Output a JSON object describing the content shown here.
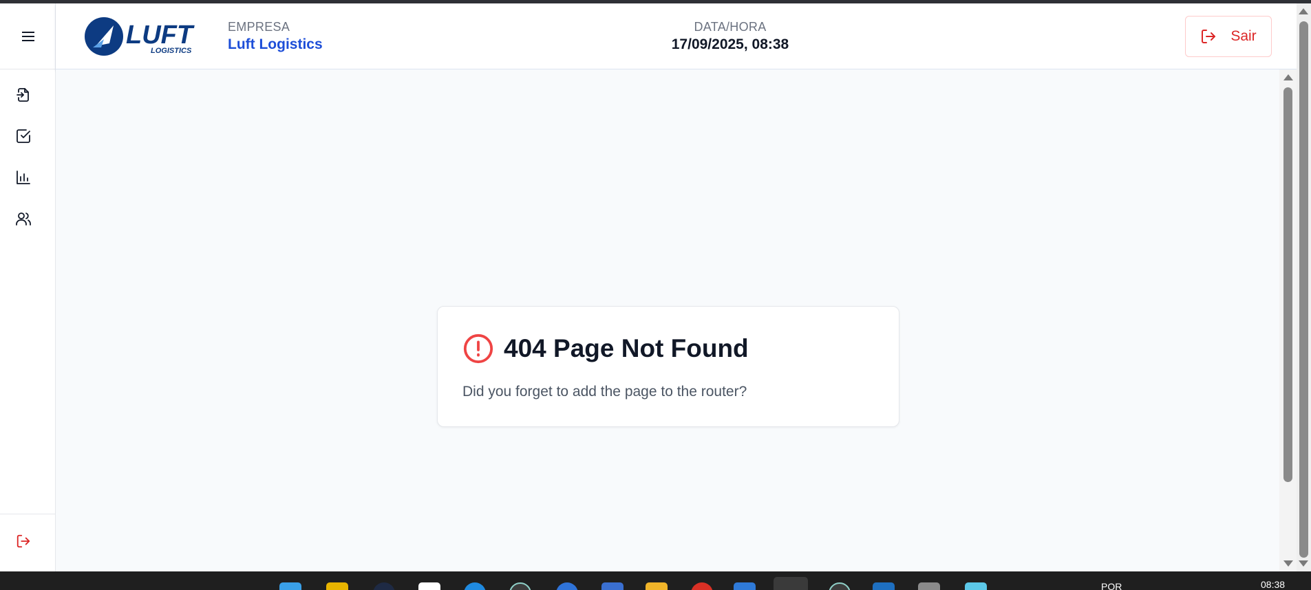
{
  "header": {
    "company_label": "EMPRESA",
    "company_name": "Luft Logistics",
    "datetime_label": "DATA/HORA",
    "datetime_value": "17/09/2025, 08:38",
    "logout_label": "Sair",
    "logo_text": "LUFT",
    "logo_subtext": "LOGISTICS"
  },
  "sidebar": {
    "items": [
      {
        "icon": "file-import-icon"
      },
      {
        "icon": "checkbox-icon"
      },
      {
        "icon": "bar-chart-icon"
      },
      {
        "icon": "users-icon"
      }
    ],
    "bottom_icon": "logout-icon"
  },
  "error_card": {
    "title": "404 Page Not Found",
    "message": "Did you forget to add the page to the router?"
  },
  "taskbar": {
    "lang": "POR",
    "time": "08:38"
  },
  "colors": {
    "brand_blue": "#1d4ed8",
    "logo_navy": "#0d3b82",
    "danger_red": "#dc2626",
    "page_bg": "#f8fafc"
  }
}
